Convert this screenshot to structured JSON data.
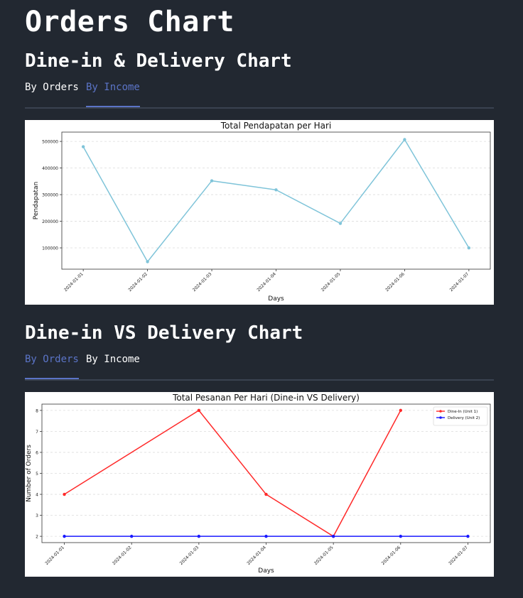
{
  "page": {
    "title": "Orders Chart"
  },
  "sections": [
    {
      "heading": "Dine-in & Delivery Chart",
      "tabs": [
        {
          "label": "By Orders",
          "state": "default"
        },
        {
          "label": "By Income",
          "state": "highlighted"
        }
      ]
    },
    {
      "heading": "Dine-in VS Delivery Chart",
      "tabs": [
        {
          "label": "By Orders",
          "state": "highlighted"
        },
        {
          "label": "By Income",
          "state": "default"
        }
      ]
    }
  ],
  "colors": {
    "background": "#222831",
    "tab_highlight": "#5b74c7",
    "income_line": "#7fc4d9",
    "dine_in": "#ff2a2a",
    "delivery": "#1a1aff"
  },
  "chart_data": [
    {
      "type": "line",
      "title": "Total Pendapatan per Hari",
      "xlabel": "Days",
      "ylabel": "Pendapatan",
      "x": [
        "2024-01-01",
        "2024-01-02",
        "2024-01-03",
        "2024-01-04",
        "2024-01-05",
        "2024-01-06",
        "2024-01-07"
      ],
      "series": [
        {
          "values": [
            480000,
            48000,
            352000,
            318000,
            192000,
            507000,
            100000
          ],
          "color": "#7fc4d9"
        }
      ],
      "yticks": [
        100000,
        200000,
        300000,
        400000,
        500000
      ],
      "ylim": [
        20000,
        535000
      ],
      "grid": "horizontal dashed",
      "legend": "none"
    },
    {
      "type": "line",
      "title": "Total Pesanan Per Hari (Dine-in VS Delivery)",
      "xlabel": "Days",
      "ylabel": "Number of Orders",
      "x": [
        "2024-01-01",
        "2024-01-02",
        "2024-01-03",
        "2024-01-04",
        "2024-01-05",
        "2024-01-06",
        "2024-01-07"
      ],
      "series": [
        {
          "name": "Dine-In (Unit 1)",
          "x": [
            "2024-01-01",
            "2024-01-03",
            "2024-01-04",
            "2024-01-05",
            "2024-01-06"
          ],
          "values": [
            4,
            8,
            4,
            2,
            8
          ],
          "color": "#ff2a2a"
        },
        {
          "name": "Delivery (Unit 2)",
          "x": [
            "2024-01-01",
            "2024-01-02",
            "2024-01-03",
            "2024-01-04",
            "2024-01-05",
            "2024-01-06",
            "2024-01-07"
          ],
          "values": [
            2,
            2,
            2,
            2,
            2,
            2,
            2
          ],
          "color": "#1a1aff"
        }
      ],
      "yticks": [
        2,
        3,
        4,
        5,
        6,
        7,
        8
      ],
      "ylim": [
        1.7,
        8.3
      ],
      "grid": "horizontal dashed",
      "legend": "top-right"
    }
  ]
}
